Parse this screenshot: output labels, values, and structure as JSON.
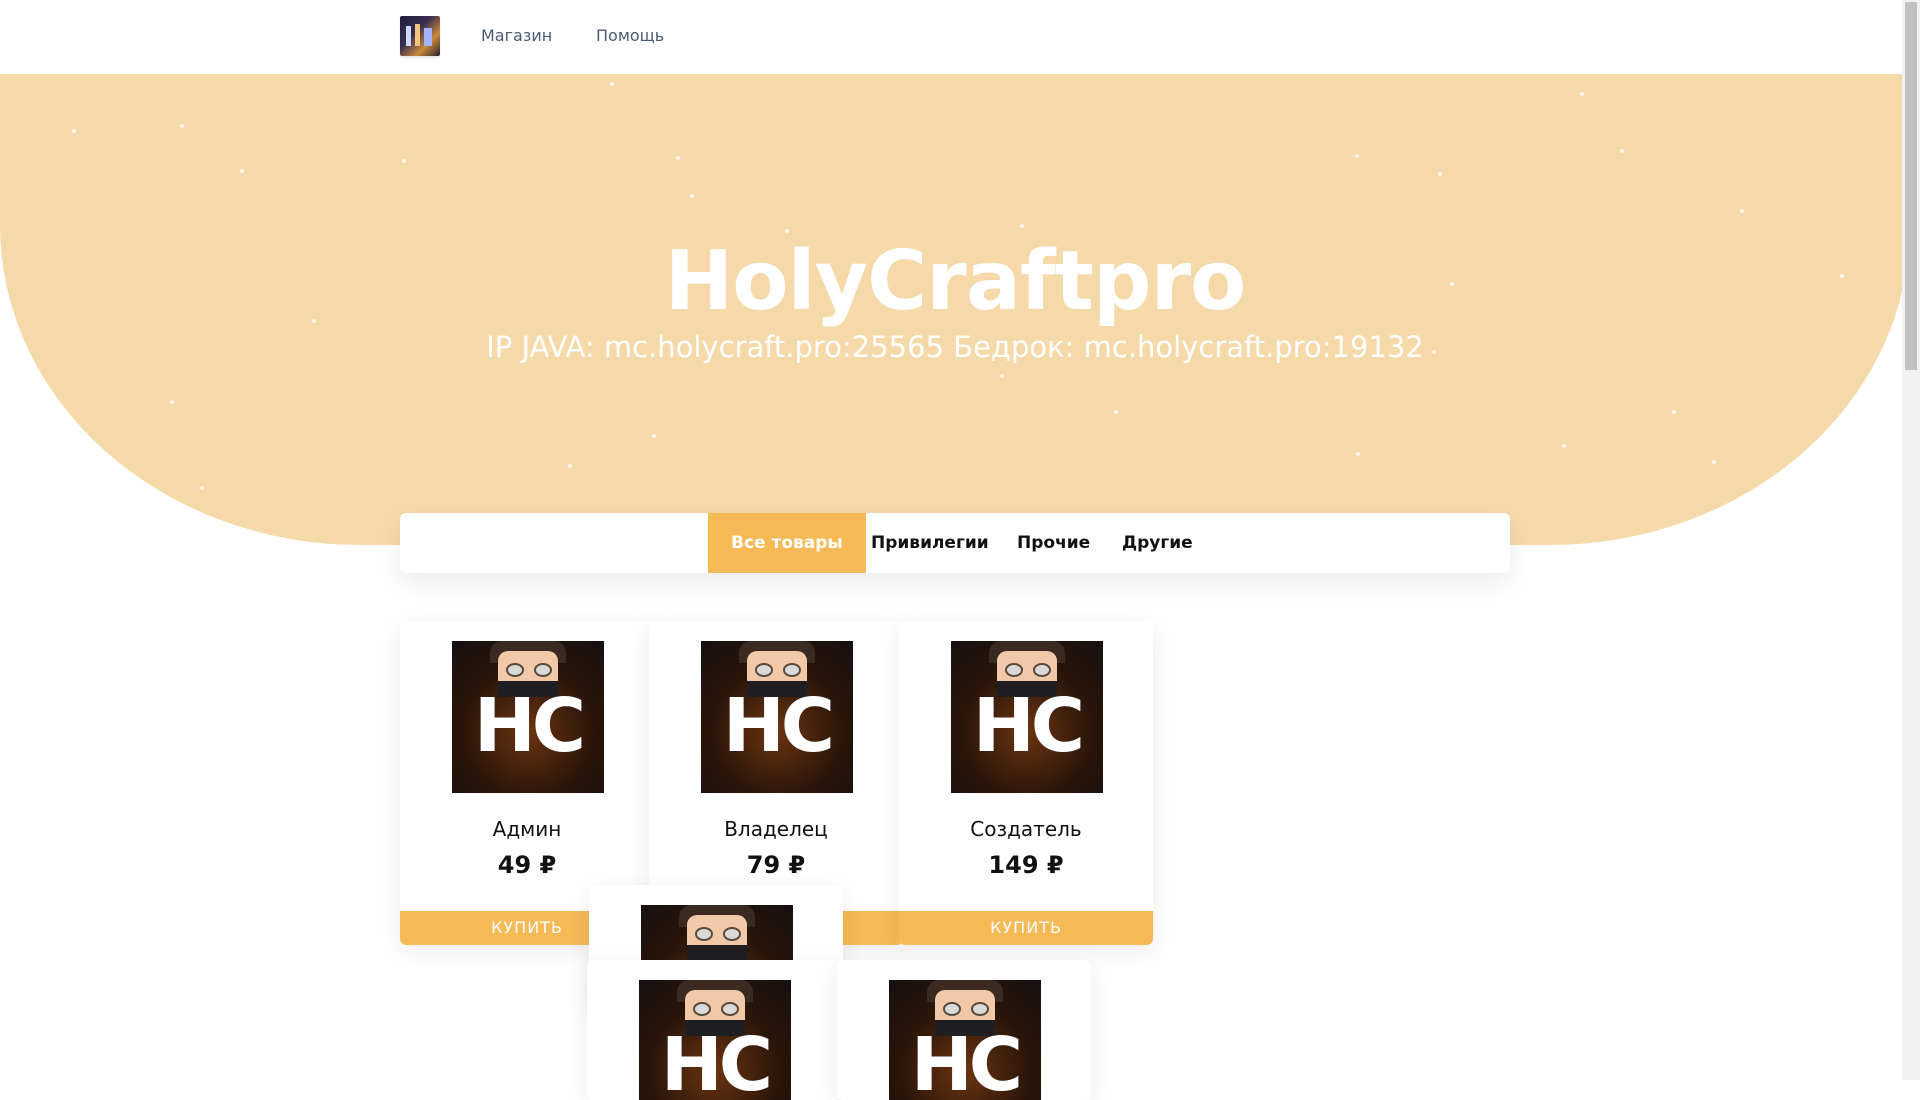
{
  "nav": {
    "shop": "Магазин",
    "help": "Помощь"
  },
  "hero": {
    "title": "HolyCraftpro",
    "subtitle": "IP JAVA: mc.holycraft.pro:25565 Бедрок: mc.holycraft.pro:19132"
  },
  "tabs": {
    "all": "Все товары",
    "privileges": "Привилегии",
    "misc": "Прочие",
    "other": "Другие"
  },
  "products": [
    {
      "name": "Админ",
      "price": "49 ₽",
      "buy": "КУПИТЬ"
    },
    {
      "name": "Владелец",
      "price": "79 ₽",
      "buy": "КУПИТЬ"
    },
    {
      "name": "Создатель",
      "price": "149 ₽",
      "buy": "КУПИТЬ"
    }
  ],
  "product_image_text": "HC",
  "colors": {
    "accent": "#f5b955",
    "hero_bg": "#f6d9a9"
  }
}
